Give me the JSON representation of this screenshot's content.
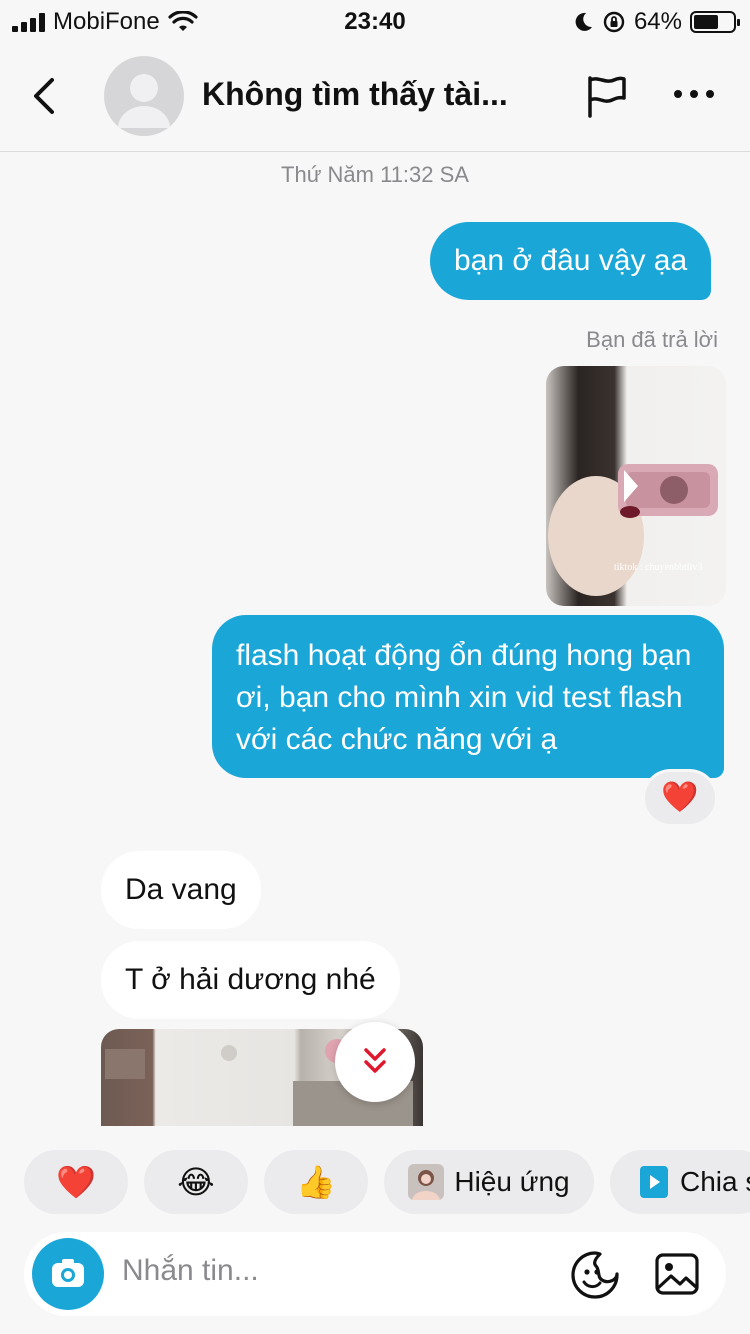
{
  "status_bar": {
    "carrier": "MobiFone",
    "time": "23:40",
    "battery": "64%",
    "battery_level": 0.64
  },
  "header": {
    "title": "Không tìm thấy tài..."
  },
  "conversation": {
    "timestamp": "Thứ Năm 11:32 SA",
    "messages": [
      {
        "direction": "outgoing",
        "text": "bạn ở đâu vậy ạa"
      },
      {
        "direction": "outgoing",
        "type": "replied-note",
        "text": "Bạn đã trả lời"
      },
      {
        "direction": "outgoing",
        "type": "video",
        "watermark": "tiktok : chuyenbbtliv3"
      },
      {
        "direction": "outgoing",
        "text": "flash hoạt động ổn đúng hong bạn ơi, bạn cho mình xin vid test flash với các chức năng với ạ",
        "reaction": "❤️"
      },
      {
        "direction": "incoming",
        "text": "Da vang"
      },
      {
        "direction": "incoming",
        "text": "T ở hải dương nhé"
      },
      {
        "direction": "incoming",
        "type": "photo"
      }
    ]
  },
  "quick_replies": [
    {
      "label": "",
      "emoji": "❤️"
    },
    {
      "label": "",
      "emoji": "😂"
    },
    {
      "label": "",
      "emoji": "👍"
    },
    {
      "label": "Hiệu ứng",
      "icon": "effects-thumbnail-icon"
    },
    {
      "label": "Chia s",
      "icon": "share-icon"
    }
  ],
  "composer": {
    "placeholder": "Nhắn tin..."
  },
  "colors": {
    "outgoing_bubble": "#1aa7d8",
    "incoming_bubble": "#ffffff",
    "background": "#f7f7f8",
    "heart": "#e0182d"
  }
}
